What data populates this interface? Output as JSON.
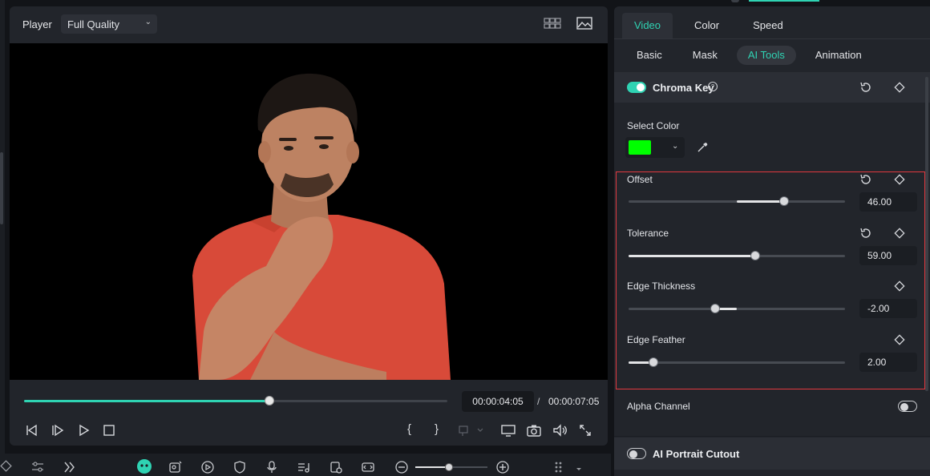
{
  "player": {
    "label": "Player",
    "quality": "Full Quality",
    "progress_fraction": 0.58,
    "current_time": "00:00:04:05",
    "time_separator": "/",
    "total_time": "00:00:07:05",
    "mark_in_label": "{",
    "mark_out_label": "}"
  },
  "zoom": {
    "level_fraction": 0.47
  },
  "panel": {
    "main_tabs": [
      "Video",
      "Color",
      "Speed"
    ],
    "active_main_tab": "Video",
    "sub_tabs": [
      "Basic",
      "Mask",
      "AI Tools",
      "Animation"
    ],
    "active_sub_tab": "AI Tools",
    "chroma_key": {
      "title": "Chroma Key",
      "enabled": true
    },
    "select_color": {
      "label": "Select Color",
      "color": "#00ff00"
    },
    "params": [
      {
        "label": "Offset",
        "value": "46.00",
        "fraction": 0.72,
        "fill_from": 0.5
      },
      {
        "label": "Tolerance",
        "value": "59.00",
        "fraction": 0.585,
        "fill_from": 0
      },
      {
        "label": "Edge Thickness",
        "value": "-2.00",
        "fraction": 0.4,
        "fill_from": 0.5
      },
      {
        "label": "Edge Feather",
        "value": "2.00",
        "fraction": 0.115,
        "fill_from": 0
      }
    ],
    "alpha_channel": {
      "label": "Alpha Channel",
      "enabled": false
    },
    "ai_portrait": {
      "title": "AI Portrait Cutout",
      "enabled": false
    }
  },
  "colors": {
    "accent": "#2fd3b3",
    "highlight_border": "#e0383e",
    "shirt": "#e0503e"
  },
  "icons": [
    "grid-layout-icon",
    "image-icon",
    "reset-icon",
    "keyframe-diamond-icon",
    "help-icon",
    "eyedropper-icon",
    "prev-frame-icon",
    "next-frame-icon",
    "play-icon",
    "stop-icon",
    "snapshot-icon",
    "volume-icon",
    "fullscreen-icon",
    "zoom-out-icon",
    "zoom-in-icon"
  ]
}
